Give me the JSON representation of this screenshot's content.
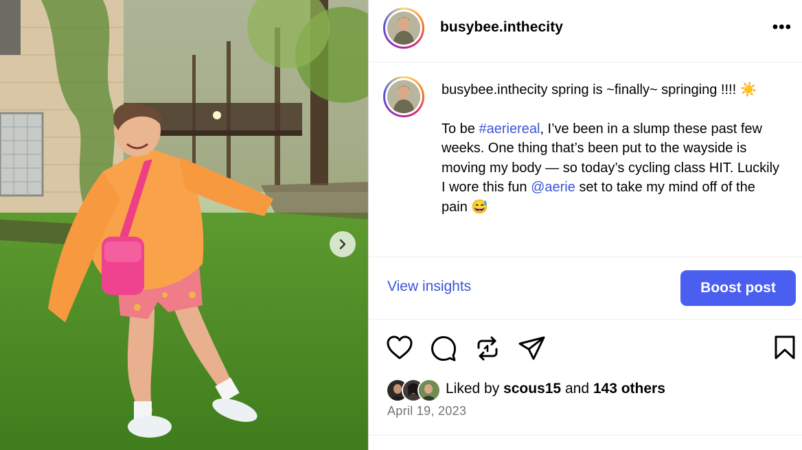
{
  "post": {
    "username": "busybee.inthecity",
    "more_label": "•••"
  },
  "caption": {
    "user": "busybee.inthecity",
    "line1": " spring is ~finally~ springing !!!! ☀️",
    "p2_a": "To be ",
    "hashtag": "#aeriereal",
    "p2_b": ", I’ve been in a slump these past few weeks. One thing that’s been put to the wayside is moving my body — so today’s cycling class HIT. Luckily I wore this fun ",
    "mention": "@aerie",
    "p2_c": " set to take my mind off of the pain 😅"
  },
  "actions": {
    "insights_label": "View insights",
    "boost_label": "Boost post",
    "icons": [
      "heart-icon",
      "comment-icon",
      "repost-icon",
      "share-icon",
      "bookmark-icon"
    ]
  },
  "likes": {
    "prefix": "Liked by ",
    "user": "scous15",
    "middle": " and ",
    "others": "143 others"
  },
  "date": "April 19, 2023",
  "colors": {
    "accent": "#4a5ef0",
    "link": "#3b54d8",
    "muted": "#737373"
  }
}
